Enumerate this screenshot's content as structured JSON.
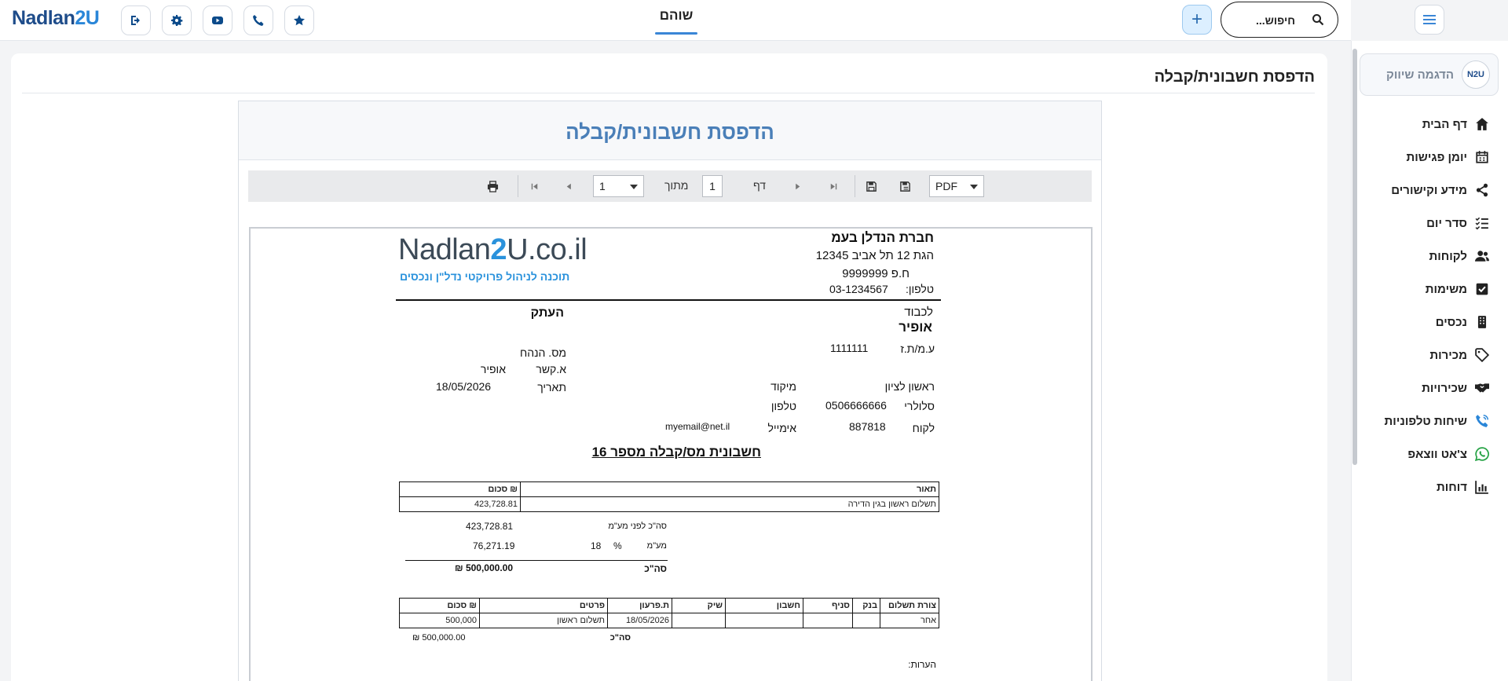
{
  "topbar": {
    "logo_part1": "Nadlan",
    "logo_part2": "2U",
    "active_tab": "שוהם",
    "search_placeholder": "חיפוש...",
    "plus_label": "+"
  },
  "sidebar": {
    "brand_name": "הדגמה שיווק",
    "brand_logo": "N2U",
    "items": [
      {
        "label": "דף הבית",
        "icon": "home-icon"
      },
      {
        "label": "יומן פגישות",
        "icon": "calendar-icon"
      },
      {
        "label": "מידע וקישורים",
        "icon": "share-icon"
      },
      {
        "label": "סדר יום",
        "icon": "checklist-icon"
      },
      {
        "label": "לקוחות",
        "icon": "users-icon"
      },
      {
        "label": "משימות",
        "icon": "checkbox-icon"
      },
      {
        "label": "נכסים",
        "icon": "building-icon"
      },
      {
        "label": "מכירות",
        "icon": "tag-icon"
      },
      {
        "label": "שכירויות",
        "icon": "handshake-icon"
      },
      {
        "label": "שיחות טלפוניות",
        "icon": "phone-call-icon"
      },
      {
        "label": "צ'אט ווצאפ",
        "icon": "whatsapp-icon"
      },
      {
        "label": "דוחות",
        "icon": "chart-icon"
      }
    ]
  },
  "main": {
    "page_title": "הדפסת חשבונית/קבלה"
  },
  "viewer": {
    "title": "הדפסת חשבונית/קבלה",
    "format": "PDF",
    "page_label": "דף",
    "page_value": "1",
    "of_label": "מתוך",
    "total_pages": "1"
  },
  "document": {
    "logo_part1": "Nadlan",
    "logo_part2": "2",
    "logo_part3": "U.co.il",
    "logo_tagline": "תוכנה לניהול פרויקטי נדל\"ן ונכסים",
    "company_name": "חברת הנדלן בעמ",
    "company_address": "הגת 12 תל אביב 12345",
    "company_hp": "ח.פ 9999999",
    "company_phone_label": "טלפון:",
    "company_phone": "03-1234567",
    "to_label": "לכבוד",
    "client_name": "אופיר",
    "copy_label": "העתק",
    "id_label": "ע.מ/ת.ז",
    "id_value": "1111111",
    "discount_label": "מס. הנהח",
    "contact_label": "א.קשר",
    "contact_value": "אופיר",
    "city_value": "ראשון לציון",
    "zip_label": "מיקוד",
    "date_label": "תאריך",
    "date_value": "18/05/2026",
    "mobile_label": "סלולרי",
    "mobile_value": "0506666666",
    "phone_label": "טלפון",
    "client_label": "לקוח",
    "client_no": "887818",
    "email_label": "אימייל",
    "email_value": "myemail@net.il",
    "invoice_title": "חשבונית מס/קבלה  מספר  16",
    "items_headers": {
      "desc": "תאור",
      "amount": "סכום ₪"
    },
    "items": [
      {
        "desc": "תשלום ראשון בגין הדירה",
        "amount": "423,728.81"
      }
    ],
    "subtotal_label": "סה\"כ לפני מע\"מ",
    "subtotal_value": "423,728.81",
    "vat_label": "מע\"מ",
    "vat_percent_sign": "%",
    "vat_rate": "18",
    "vat_value": "76,271.19",
    "total_label": "סה\"כ",
    "total_value": "₪ 500,000.00",
    "payments_headers": {
      "method": "צורת תשלום",
      "bank": "בנק",
      "branch": "סניף",
      "account": "חשבון",
      "check": "שיק",
      "due_date": "ת.פרעון",
      "details": "פרטים",
      "amount": "סכום ₪"
    },
    "payments": [
      {
        "method": "אחר",
        "bank": "",
        "branch": "",
        "account": "",
        "check": "",
        "due_date": "18/05/2026",
        "details": "תשלום ראשון",
        "amount": "500,000"
      }
    ],
    "payments_total_label": "סה\"כ",
    "payments_total_value": "₪ 500,000.00",
    "notes_label": "הערות:"
  },
  "colors": {
    "brand_dark": "#1e4c8a",
    "brand_light": "#2a86d8",
    "accent_tab": "#3a86d6",
    "viewer_title": "#4a7fb8"
  }
}
